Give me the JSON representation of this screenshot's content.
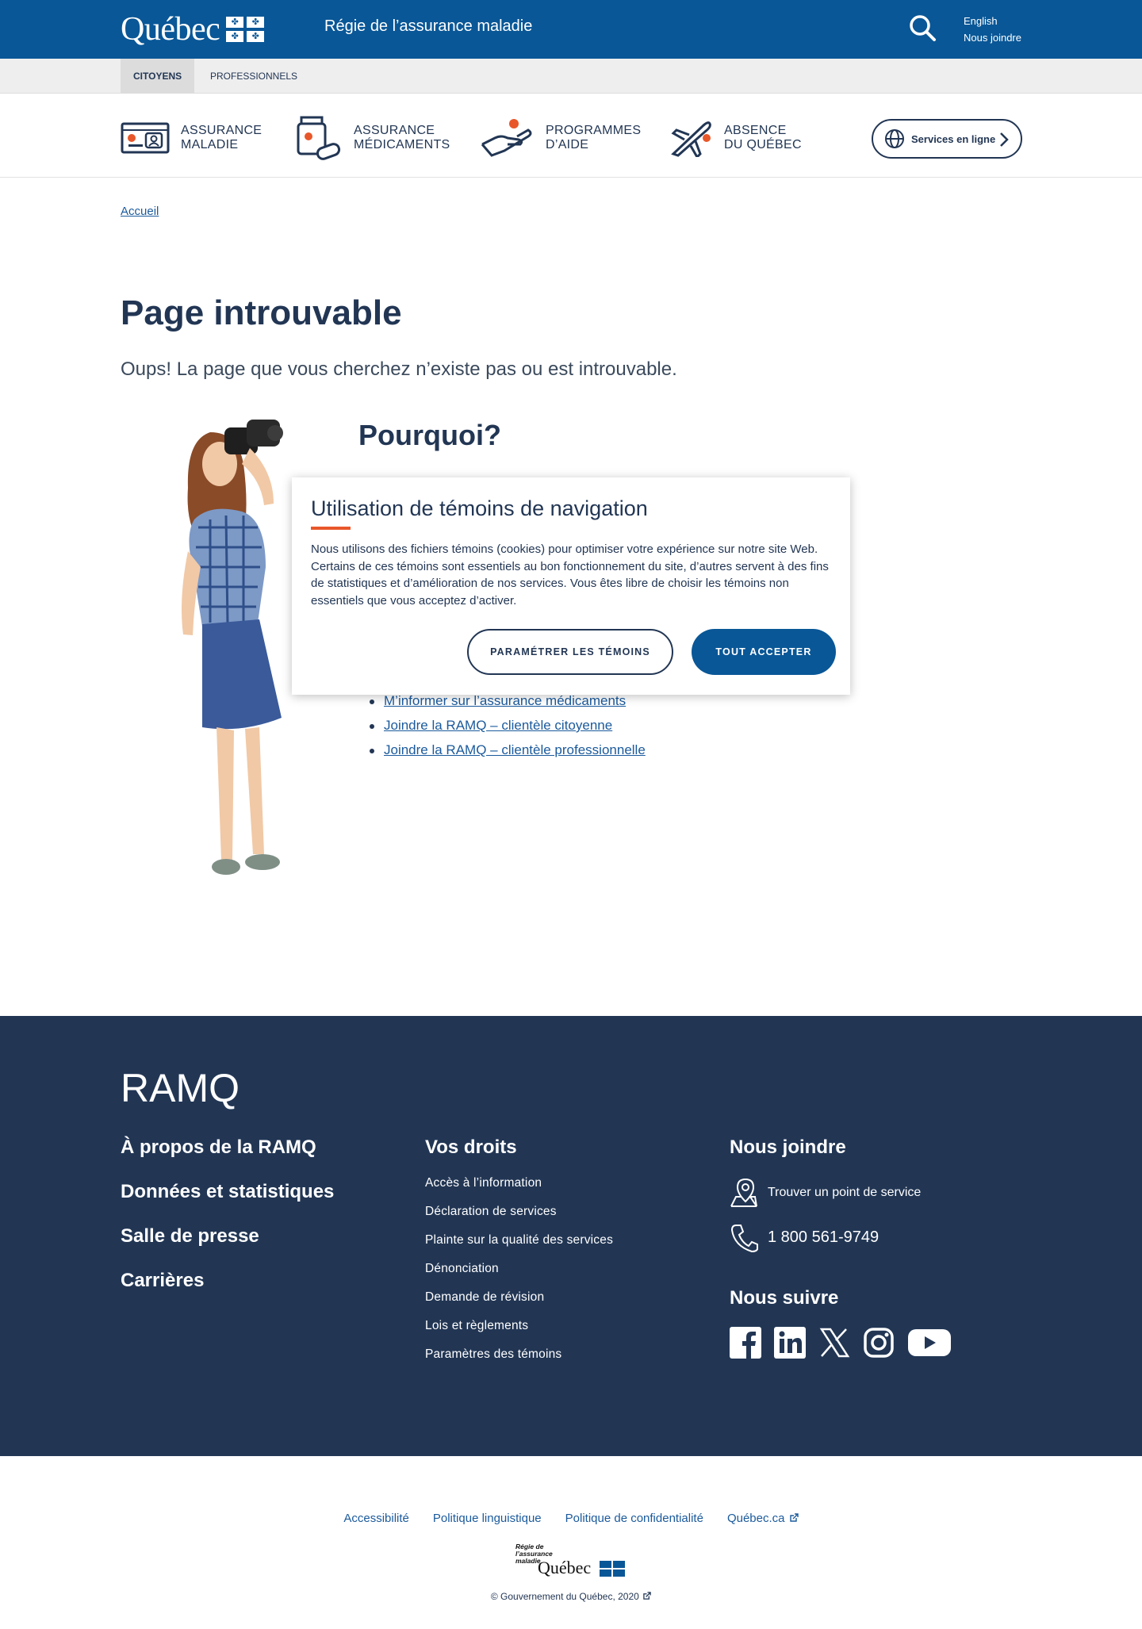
{
  "header": {
    "logo_text": "Québec",
    "site_name": "Régie de l’assurance maladie",
    "lang_link": "English",
    "contact_link": "Nous joindre"
  },
  "audience_tabs": [
    "CITOYENS",
    "PROFESSIONNELS"
  ],
  "main_nav": [
    {
      "line1": "ASSURANCE",
      "line2": "MALADIE",
      "icon": "health-card-icon"
    },
    {
      "line1": "ASSURANCE",
      "line2": "MÉDICAMENTS",
      "icon": "medication-icon"
    },
    {
      "line1": "PROGRAMMES",
      "line2": "D’AIDE",
      "icon": "helping-hand-icon"
    },
    {
      "line1": "ABSENCE",
      "line2": "DU QUÉBEC",
      "icon": "airplane-icon"
    }
  ],
  "services_button": "Services en ligne",
  "breadcrumb": "Accueil",
  "page": {
    "title": "Page introuvable",
    "lead": "Oups! La page que vous cherchez n’existe pas ou est introuvable.",
    "why_title": "Pourquoi?",
    "links": [
      "M’informer sur l’assurance médicaments",
      "Joindre la RAMQ – clientèle citoyenne",
      "Joindre la RAMQ – clientèle professionnelle"
    ]
  },
  "cookie_banner": {
    "title": "Utilisation de témoins de navigation",
    "body": "Nous utilisons des fichiers témoins (cookies) pour optimiser votre expérience sur notre site Web. Certains de ces témoins sont essentiels au bon fonctionnement du site, d’autres servent à des fins de statistiques et d’amélioration de nos services. Vous êtes libre de choisir les témoins non essentiels que vous acceptez d’activer.",
    "settings_button": "PARAMÉTRER LES TÉMOINS",
    "accept_button": "TOUT ACCEPTER"
  },
  "footer": {
    "brand": "RAMQ",
    "col1": [
      "À propos de la RAMQ",
      "Données et statistiques",
      "Salle de presse",
      "Carrières"
    ],
    "rights_heading": "Vos droits",
    "rights_links": [
      "Accès à l’information",
      "Déclaration de services",
      "Plainte sur la qualité des services",
      "Dénonciation",
      "Demande de révision",
      "Lois et règlements",
      "Paramètres des témoins"
    ],
    "contact_heading": "Nous joindre",
    "service_point": "Trouver un point de service",
    "phone": "1 800 561-9749",
    "follow_heading": "Nous suivre"
  },
  "subfooter": {
    "links": [
      "Accessibilité",
      "Politique linguistique",
      "Politique de confidentialité",
      "Québec.ca"
    ],
    "logo_small": "Régie de l’assurance maladie",
    "logo_word": "Québec",
    "copyright": "© Gouvernement du Québec, 2020"
  },
  "colors": {
    "primary_blue": "#095797",
    "navy": "#223654",
    "accent_orange": "#e8572a",
    "link": "#1b5a9c"
  }
}
